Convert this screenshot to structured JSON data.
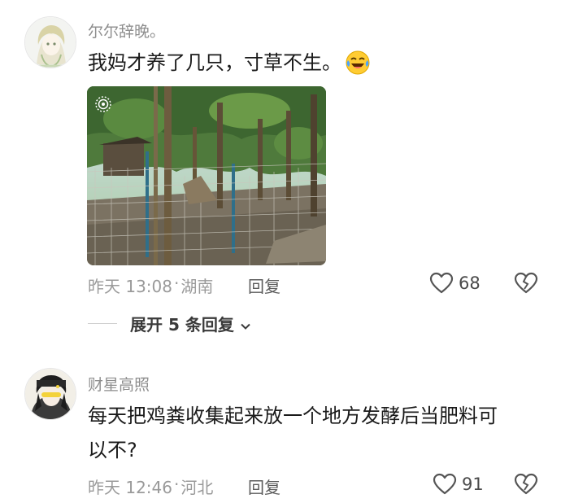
{
  "comments": [
    {
      "username": "尔尔辞晚。",
      "text": "我妈才养了几只，寸草不生。",
      "emoji": "😂",
      "time": "昨天 13:08",
      "location": "湖南",
      "reply_label": "回复",
      "likes": "68"
    },
    {
      "username": "财星高照",
      "text_line1": "每天把鸡粪收集起来放一个地方发酵后当肥料可",
      "text_line2": "以不?",
      "time": "昨天 12:46",
      "location": "河北",
      "reply_label": "回复",
      "likes": "91"
    }
  ],
  "expand_replies": "展开 5 条回复",
  "meta_separator": "·",
  "colors": {
    "meta_gray": "#9a9a9a",
    "text": "#1a1a1a",
    "icon_gray": "#555555"
  },
  "icons": [
    "heart-icon",
    "broken-heart-icon",
    "chevron-down-icon",
    "live-photo-icon",
    "laughing-tears-emoji"
  ]
}
